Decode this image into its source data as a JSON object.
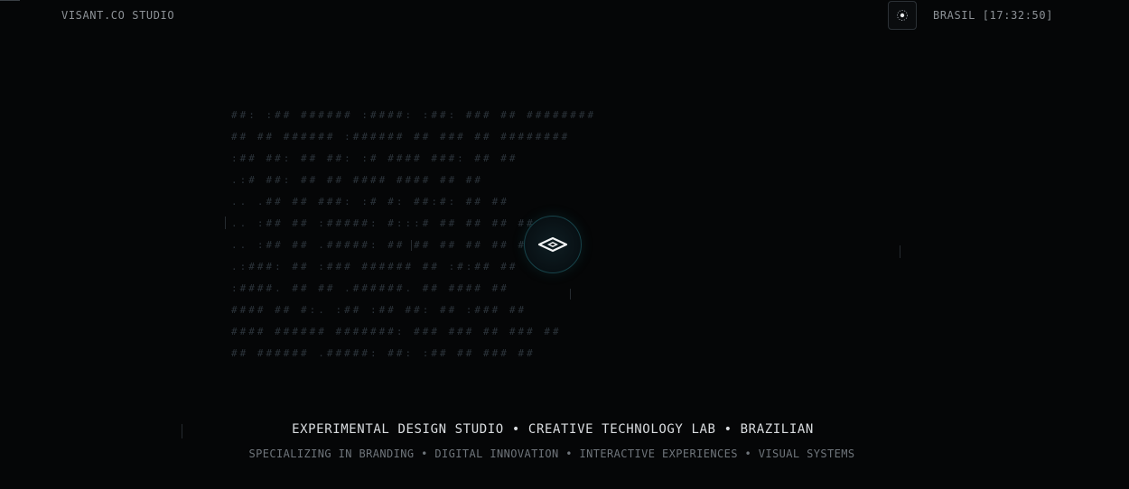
{
  "header": {
    "brand": "VISANT.CO STUDIO",
    "clock": "BRASIL [17:32:50]",
    "settings_icon": "target-icon"
  },
  "hero": {
    "ascii_lines": [
      "##:   :##    ######      :####:        :##:      ###    ##   ########",
      " ##     ##    ######     :######         ##      ###    ##   ########",
      "  :##   ##:       ##     ##:   :#       ####     ###:   ##      ##",
      "  .:#   ##:       ##     ##             ####     ####   ##      ##",
      "  ..  .##         ##     ###:          :#   #:   ##:#:  ##      ##",
      "  ..  :##         ##     :#####:       #:::#     ## ##  ##      ##",
      "  ..  :##         ##      .#####:     ##   ##    ## ##  ##      ##",
      "  .:###:          ##        :###     ######      ## :#:##       ##",
      "  :####.          ##           ##   .######.     ##  ####       ##",
      "   ####           ##     #:.   :##  :##   ##:    ##  :###       ##",
      "   ####       ######     #######:  ###    ###    ##   ###       ##",
      "     ##       ######    .#####:    ##:   :##     ##   ###       ##"
    ],
    "logo_icon": "visant-diamond-eye-icon"
  },
  "footer": {
    "tagline": "EXPERIMENTAL DESIGN STUDIO • CREATIVE TECHNOLOGY LAB • BRAZILIAN",
    "subline": "SPECIALIZING IN BRANDING • DIGITAL INNOVATION • INTERACTIVE EXPERIENCES • VISUAL SYSTEMS"
  },
  "colors": {
    "background": "#050607",
    "ascii": "#2c343b",
    "ascii_glow": "#1f6f76",
    "accent": "#17434a",
    "text": "#d9dcdf",
    "muted": "#6f757b"
  }
}
